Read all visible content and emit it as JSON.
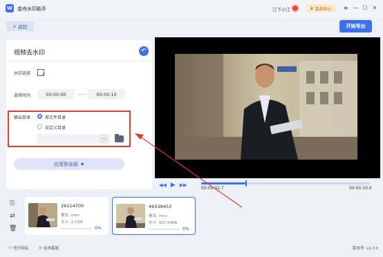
{
  "app": {
    "logo_letter": "W",
    "title": "金舟水印助手",
    "user_name": "江下小江",
    "member_label": "会员中心",
    "window_controls": [
      "≡",
      "—",
      "☐",
      "✕"
    ]
  },
  "toolbar": {
    "back_label": "返回",
    "export_label": "开始导出"
  },
  "panel": {
    "title": "视频去水印",
    "watermark_select_label": "水印选择",
    "time_label": "选择时间",
    "start_time": "00:00:00",
    "end_time": "00:00:10",
    "output_label": "输出目录",
    "radio_source": "原文件目录",
    "radio_custom": "自定义目录",
    "path_value": "",
    "more_label": "···",
    "apply_label": "应用到全部"
  },
  "player": {
    "current_time": "00:00:02.7",
    "total_time": "00:00:10.0",
    "progress_fraction": 0.26
  },
  "files": [
    {
      "name": "26114700",
      "format": "格式: mov",
      "size": "大小: 2.72M",
      "percent": "0%",
      "selected": false
    },
    {
      "name": "46539453",
      "format": "格式: mov",
      "size": "大小: 957.54KB",
      "percent": "0%",
      "selected": true
    }
  ],
  "footer": {
    "website_label": "官方网站",
    "support_label": "在线客服",
    "version_label": "版本号: v2.0.0"
  },
  "colors": {
    "accent": "#3e6ff0",
    "highlight": "#e03a33"
  }
}
